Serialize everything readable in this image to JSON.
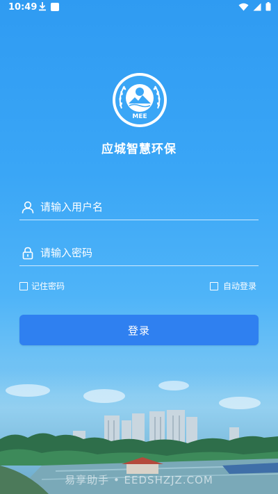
{
  "status_bar": {
    "time": "10:49"
  },
  "app": {
    "title": "应城智慧环保",
    "logo_text": "MEE"
  },
  "form": {
    "username_placeholder": "请输入用户名",
    "password_placeholder": "请输入密码",
    "remember_label": "记住密码",
    "auto_login_label": "自动登录",
    "login_label": "登录"
  },
  "watermark": "易享助手 • EEDSHZJZ.COM",
  "colors": {
    "background": "#3aa6f6",
    "button": "#2f80f0"
  }
}
